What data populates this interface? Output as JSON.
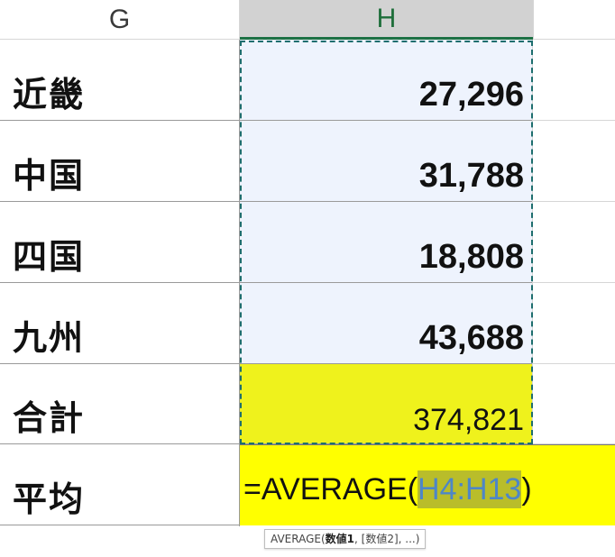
{
  "columns": {
    "g": "G",
    "h": "H"
  },
  "rows": [
    {
      "label": "近畿",
      "value": "27,296"
    },
    {
      "label": "中国",
      "value": "31,788"
    },
    {
      "label": "四国",
      "value": "18,808"
    },
    {
      "label": "九州",
      "value": "43,688"
    },
    {
      "label": "合計",
      "value": "374,821"
    }
  ],
  "edit_row": {
    "label": "平均",
    "formula_prefix": "=AVERAGE(",
    "formula_ref": "H4:H13",
    "formula_suffix": ")"
  },
  "tooltip": {
    "func": "AVERAGE(",
    "arg1": "数値1",
    "rest": ", [数値2], ...)"
  },
  "colors": {
    "total_fill": "#eff21c",
    "edit_fill": "#ffff00",
    "selection_fill": "#eef3fd",
    "header_accent": "#1e7145"
  }
}
